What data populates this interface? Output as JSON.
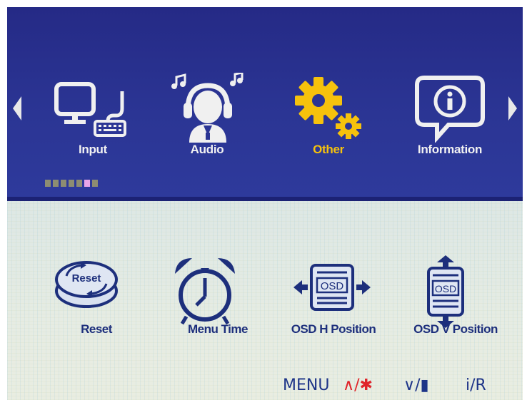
{
  "nav": {
    "prev_arrow": "arrow-left",
    "next_arrow": "arrow-right",
    "tabs": [
      {
        "label": "Input",
        "icon": "monitor-keyboard-icon",
        "active": false
      },
      {
        "label": "Audio",
        "icon": "headphones-person-icon",
        "active": false
      },
      {
        "label": "Other",
        "icon": "gears-icon",
        "active": true
      },
      {
        "label": "Information",
        "icon": "info-bubble-icon",
        "active": false
      }
    ],
    "page_indicator": {
      "total": 7,
      "current": 6
    }
  },
  "items": [
    {
      "label": "Reset",
      "icon": "reset-button-icon",
      "icon_text": "Reset"
    },
    {
      "label": "Menu Time",
      "icon": "alarm-clock-icon"
    },
    {
      "label": "OSD H Position",
      "icon": "osd-horizontal-icon",
      "icon_text": "OSD"
    },
    {
      "label": "OSD V Position",
      "icon": "osd-vertical-icon",
      "icon_text": "OSD"
    }
  ],
  "footer": {
    "menu": "MENU",
    "up_key": "∧/✱",
    "down_key": "∨/▮",
    "info_key": "i/R"
  },
  "colors": {
    "top_bg": "#2b3594",
    "active_tab": "#f6c20c",
    "bottom_text": "#1d2f7c",
    "hint_red": "#e0242a"
  }
}
